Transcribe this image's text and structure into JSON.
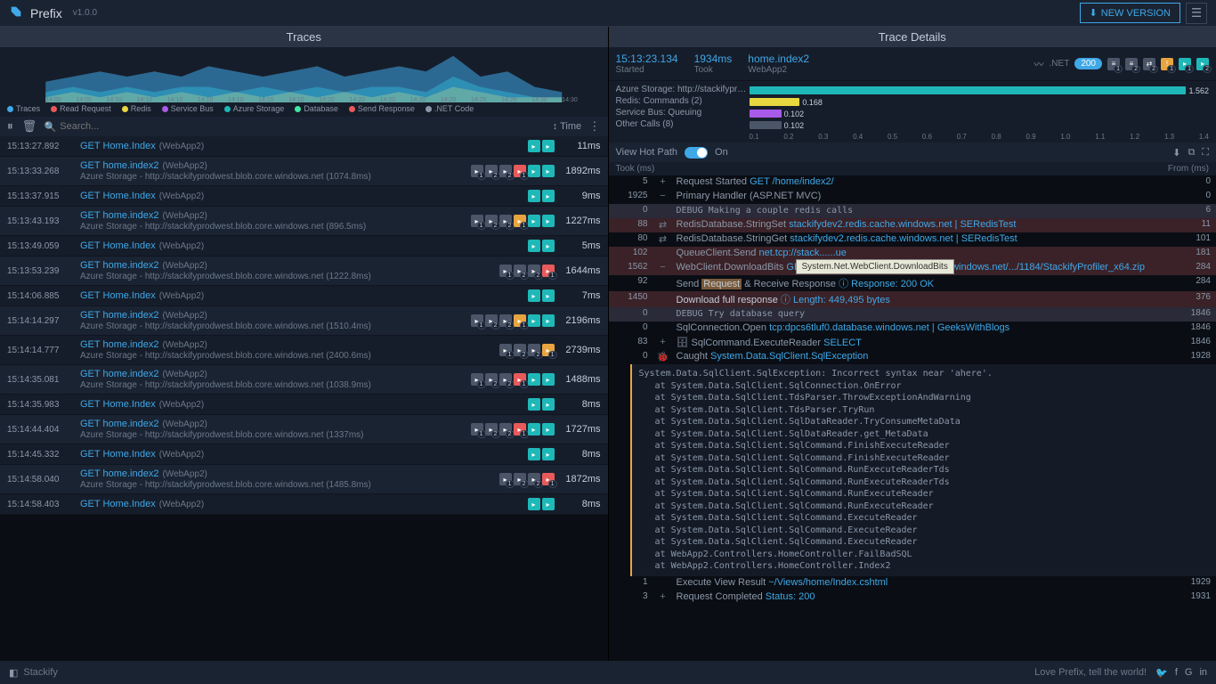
{
  "app": {
    "name": "Prefix",
    "version": "v1.0.0",
    "new_version_label": "NEW VERSION"
  },
  "panels": {
    "left": "Traces",
    "right": "Trace Details"
  },
  "legend": [
    {
      "label": "Traces",
      "color": "#3fa8e8"
    },
    {
      "label": "Read Request",
      "color": "#e85a5a"
    },
    {
      "label": "Redis",
      "color": "#e8d83f"
    },
    {
      "label": "Service Bus",
      "color": "#a85ae8"
    },
    {
      "label": "Azure Storage",
      "color": "#1fb8b8"
    },
    {
      "label": "Database",
      "color": "#3fe8a4"
    },
    {
      "label": "Send Response",
      "color": "#e85a5a"
    },
    {
      "label": ".NET Code",
      "color": "#8b97a8"
    }
  ],
  "chart_data": {
    "type": "area",
    "xlabel": "",
    "ylabel": "Traces",
    "ylim": [
      0,
      10
    ],
    "x_ticks": [
      "14:00",
      "14:00",
      "14:10",
      "14:10",
      "14:10",
      "14:10",
      "14:10",
      "14:10",
      "14:10",
      "14:20",
      "14:20",
      "14:20",
      "14:20",
      "14:20",
      "14:20",
      "14:20",
      "14:30",
      "14:30"
    ],
    "series": [
      {
        "name": "Traces",
        "color": "#3fa8e8",
        "values": [
          4,
          5,
          6,
          5,
          6,
          5,
          7,
          6,
          5,
          6,
          7,
          5,
          6,
          7,
          6,
          9,
          5,
          6,
          3,
          2
        ]
      },
      {
        "name": "Redis",
        "color": "#e8d83f",
        "values": [
          1,
          2,
          1,
          2,
          1,
          2,
          1,
          2,
          1,
          2,
          1,
          2,
          1,
          2,
          1,
          3,
          2,
          1,
          1,
          1
        ]
      },
      {
        "name": "Azure Storage",
        "color": "#1fb8b8",
        "values": [
          2,
          3,
          2,
          3,
          2,
          3,
          3,
          2,
          3,
          2,
          3,
          2,
          3,
          3,
          2,
          5,
          3,
          2,
          1,
          1
        ]
      }
    ]
  },
  "toolbar": {
    "search_placeholder": "Search...",
    "time_label": "Time"
  },
  "traces": [
    {
      "ts": "15:13:27.892",
      "title": "GET Home.Index",
      "app": "(WebApp2)",
      "sub": "",
      "dur": "11ms",
      "icons": [
        {
          "c": "teal"
        },
        {
          "c": "teal"
        }
      ]
    },
    {
      "ts": "15:13:33.268",
      "title": "GET home.index2",
      "app": "(WebApp2)",
      "sub": "Azure Storage - http://stackifyprodwest.blob.core.windows.net (1074.8ms)",
      "dur": "1892ms",
      "icons": [
        {
          "c": "gray",
          "n": "1"
        },
        {
          "c": "gray",
          "n": "2"
        },
        {
          "c": "gray",
          "n": "2"
        },
        {
          "c": "red",
          "n": "1"
        },
        {
          "c": "teal"
        },
        {
          "c": "teal"
        }
      ]
    },
    {
      "ts": "15:13:37.915",
      "title": "GET Home.Index",
      "app": "(WebApp2)",
      "sub": "",
      "dur": "9ms",
      "icons": [
        {
          "c": "teal"
        },
        {
          "c": "teal"
        }
      ]
    },
    {
      "ts": "15:13:43.193",
      "title": "GET home.index2",
      "app": "(WebApp2)",
      "sub": "Azure Storage - http://stackifyprodwest.blob.core.windows.net (896.5ms)",
      "dur": "1227ms",
      "icons": [
        {
          "c": "gray",
          "n": "1"
        },
        {
          "c": "gray",
          "n": "2"
        },
        {
          "c": "gray",
          "n": "2"
        },
        {
          "c": "orange",
          "n": "1"
        },
        {
          "c": "teal"
        },
        {
          "c": "teal"
        }
      ]
    },
    {
      "ts": "15:13:49.059",
      "title": "GET Home.Index",
      "app": "(WebApp2)",
      "sub": "",
      "dur": "5ms",
      "icons": [
        {
          "c": "teal"
        },
        {
          "c": "teal"
        }
      ]
    },
    {
      "ts": "15:13:53.239",
      "title": "GET home.index2",
      "app": "(WebApp2)",
      "sub": "Azure Storage - http://stackifyprodwest.blob.core.windows.net (1222.8ms)",
      "dur": "1644ms",
      "icons": [
        {
          "c": "gray",
          "n": "1"
        },
        {
          "c": "gray",
          "n": "2"
        },
        {
          "c": "gray",
          "n": "2"
        },
        {
          "c": "red",
          "n": "1"
        }
      ]
    },
    {
      "ts": "15:14:06.885",
      "title": "GET Home.Index",
      "app": "(WebApp2)",
      "sub": "",
      "dur": "7ms",
      "icons": [
        {
          "c": "teal"
        },
        {
          "c": "teal"
        }
      ]
    },
    {
      "ts": "15:14:14.297",
      "title": "GET home.index2",
      "app": "(WebApp2)",
      "sub": "Azure Storage - http://stackifyprodwest.blob.core.windows.net (1510.4ms)",
      "dur": "2196ms",
      "icons": [
        {
          "c": "gray",
          "n": "1"
        },
        {
          "c": "gray",
          "n": "2"
        },
        {
          "c": "gray",
          "n": "2"
        },
        {
          "c": "orange",
          "n": "1"
        },
        {
          "c": "teal"
        },
        {
          "c": "teal"
        }
      ]
    },
    {
      "ts": "15:14:14.777",
      "title": "GET home.index2",
      "app": "(WebApp2)",
      "sub": "Azure Storage - http://stackifyprodwest.blob.core.windows.net (2400.6ms)",
      "dur": "2739ms",
      "icons": [
        {
          "c": "gray",
          "n": "1"
        },
        {
          "c": "gray",
          "n": "2"
        },
        {
          "c": "gray",
          "n": "2"
        },
        {
          "c": "orange",
          "n": "1"
        }
      ]
    },
    {
      "ts": "15:14:35.081",
      "title": "GET home.index2",
      "app": "(WebApp2)",
      "sub": "Azure Storage - http://stackifyprodwest.blob.core.windows.net (1038.9ms)",
      "dur": "1488ms",
      "icons": [
        {
          "c": "gray",
          "n": "1"
        },
        {
          "c": "gray",
          "n": "2"
        },
        {
          "c": "gray",
          "n": "2"
        },
        {
          "c": "red",
          "n": "1"
        },
        {
          "c": "teal"
        },
        {
          "c": "teal"
        }
      ]
    },
    {
      "ts": "15:14:35.983",
      "title": "GET Home.Index",
      "app": "(WebApp2)",
      "sub": "",
      "dur": "8ms",
      "icons": [
        {
          "c": "teal"
        },
        {
          "c": "teal"
        }
      ]
    },
    {
      "ts": "15:14:44.404",
      "title": "GET home.index2",
      "app": "(WebApp2)",
      "sub": "Azure Storage - http://stackifyprodwest.blob.core.windows.net (1337ms)",
      "dur": "1727ms",
      "icons": [
        {
          "c": "gray",
          "n": "1"
        },
        {
          "c": "gray",
          "n": "2"
        },
        {
          "c": "gray",
          "n": "2"
        },
        {
          "c": "red",
          "n": "1"
        },
        {
          "c": "teal"
        },
        {
          "c": "teal"
        }
      ]
    },
    {
      "ts": "15:14:45.332",
      "title": "GET Home.Index",
      "app": "(WebApp2)",
      "sub": "",
      "dur": "8ms",
      "icons": [
        {
          "c": "teal"
        },
        {
          "c": "teal"
        }
      ]
    },
    {
      "ts": "15:14:58.040",
      "title": "GET home.index2",
      "app": "(WebApp2)",
      "sub": "Azure Storage - http://stackifyprodwest.blob.core.windows.net (1485.8ms)",
      "dur": "1872ms",
      "icons": [
        {
          "c": "gray",
          "n": "1"
        },
        {
          "c": "gray",
          "n": "2"
        },
        {
          "c": "gray",
          "n": "2"
        },
        {
          "c": "red",
          "n": "1"
        }
      ]
    },
    {
      "ts": "15:14:58.403",
      "title": "GET Home.Index",
      "app": "(WebApp2)",
      "sub": "",
      "dur": "8ms",
      "icons": [
        {
          "c": "teal"
        },
        {
          "c": "teal"
        }
      ]
    }
  ],
  "footer": {
    "brand": "Stackify",
    "tagline": "Love Prefix, tell the world!"
  },
  "detail_header": {
    "started": "15:13:23.134",
    "started_lbl": "Started",
    "took": "1934ms",
    "took_lbl": "Took",
    "route": "home.index2",
    "app": "WebApp2",
    "net": ".NET",
    "status": "200"
  },
  "detail_bars": {
    "rows": [
      {
        "label": "Azure Storage: http://stackifyprodwes...",
        "color": "#1fb8b8",
        "val": 1.562,
        "pct": 100
      },
      {
        "label": "Redis: Commands (2)",
        "color": "#e8d83f",
        "val": 0.168,
        "pct": 11
      },
      {
        "label": "Service Bus: Queuing",
        "color": "#a85ae8",
        "val": 0.102,
        "pct": 7
      },
      {
        "label": "Other Calls (8)",
        "color": "#4a5568",
        "val": 0.102,
        "pct": 7
      }
    ],
    "axis": [
      "0.1",
      "0.2",
      "0.3",
      "0.4",
      "0.5",
      "0.6",
      "0.7",
      "0.8",
      "0.9",
      "1.0",
      "1.1",
      "1.2",
      "1.3",
      "1.4"
    ]
  },
  "hotpath": {
    "label": "View Hot Path",
    "on": "On"
  },
  "columns": {
    "took": "Took (ms)",
    "from": "From (ms)"
  },
  "tooltip": "System.Net.WebClient.DownloadBits",
  "events": [
    {
      "took": "5",
      "g": "+",
      "body": [
        {
          "t": "Request Started ",
          "c": "gray"
        },
        {
          "t": "GET /home/index2/",
          "c": "link"
        }
      ],
      "from": "0"
    },
    {
      "took": "1925",
      "g": "−",
      "body": [
        {
          "t": "Primary Handler (ASP.NET MVC)",
          "c": "gray"
        }
      ],
      "from": "0"
    },
    {
      "took": "0",
      "g": "",
      "mono": "DEBUG Making a couple redis calls",
      "from": "6",
      "cls": "hl2"
    },
    {
      "took": "88",
      "g": "⇄",
      "body": [
        {
          "t": "RedisDatabase.StringSet  ",
          "c": "gray"
        },
        {
          "t": "stackifydev2.redis.cache.windows.net | SERedisTest",
          "c": "link"
        }
      ],
      "from": "11",
      "cls": "hl"
    },
    {
      "took": "80",
      "g": "⇄",
      "body": [
        {
          "t": "RedisDatabase.StringGet  ",
          "c": "gray"
        },
        {
          "t": "stackifydev2.redis.cache.windows.net | SERedisTest",
          "c": "link"
        }
      ],
      "from": "101"
    },
    {
      "took": "102",
      "g": "",
      "body": [
        {
          "t": "QueueClient.Send  ",
          "c": "gray"
        },
        {
          "t": "net.tcp://stack...",
          "c": "link"
        },
        {
          "t": "...ue",
          "c": "link"
        }
      ],
      "from": "181",
      "cls": "hl"
    },
    {
      "took": "1562",
      "g": "−",
      "body": [
        {
          "t": "WebClient.DownloadBits  ",
          "c": "gray"
        },
        {
          "t": "GET ",
          "c": "link"
        },
        {
          "t": "http://stackifyprodwest.blob.core.windows.net/.../1184/StackifyProfiler_x64.zip",
          "c": "link"
        }
      ],
      "from": "284",
      "cls": "hl"
    },
    {
      "took": "92",
      "g": "",
      "body": [
        {
          "t": "Send ",
          "c": "gray"
        },
        {
          "t": "Request",
          "c": "white",
          "bg": "#7a5a3a"
        },
        {
          "t": " & Receive Response ",
          "c": "gray"
        },
        {
          "t": "ⓘ  Response: 200 OK",
          "c": "link"
        }
      ],
      "from": "284"
    },
    {
      "took": "1450",
      "g": "",
      "body": [
        {
          "t": "Download full response ",
          "c": "white"
        },
        {
          "t": "ⓘ  Length: 449,495 bytes",
          "c": "link"
        }
      ],
      "from": "376",
      "cls": "hl"
    },
    {
      "took": "0",
      "g": "",
      "mono": "DEBUG Try database query",
      "from": "1846",
      "cls": "hl2"
    },
    {
      "took": "0",
      "g": "",
      "body": [
        {
          "t": "SqlConnection.Open  ",
          "c": "gray"
        },
        {
          "t": "tcp:dpcs6tluf0.database.windows.net | GeeksWithBlogs",
          "c": "link"
        }
      ],
      "from": "1846"
    },
    {
      "took": "83",
      "g": "+",
      "body": [
        {
          "t": "🗄 SqlCommand.ExecuteReader  ",
          "c": "gray"
        },
        {
          "t": "SELECT",
          "c": "link"
        }
      ],
      "from": "1846"
    },
    {
      "took": "0",
      "g": "🐞",
      "body": [
        {
          "t": "Caught  ",
          "c": "gray"
        },
        {
          "t": "System.Data.SqlClient.SqlException",
          "c": "link"
        }
      ],
      "from": "1928"
    }
  ],
  "stack": [
    "System.Data.SqlClient.SqlException: Incorrect syntax near 'ahere'.",
    "   at System.Data.SqlClient.SqlConnection.OnError",
    "   at System.Data.SqlClient.TdsParser.ThrowExceptionAndWarning",
    "   at System.Data.SqlClient.TdsParser.TryRun",
    "   at System.Data.SqlClient.SqlDataReader.TryConsumeMetaData",
    "   at System.Data.SqlClient.SqlDataReader.get_MetaData",
    "   at System.Data.SqlClient.SqlCommand.FinishExecuteReader",
    "   at System.Data.SqlClient.SqlCommand.FinishExecuteReader",
    "   at System.Data.SqlClient.SqlCommand.RunExecuteReaderTds",
    "   at System.Data.SqlClient.SqlCommand.RunExecuteReaderTds",
    "   at System.Data.SqlClient.SqlCommand.RunExecuteReader",
    "   at System.Data.SqlClient.SqlCommand.RunExecuteReader",
    "   at System.Data.SqlClient.SqlCommand.ExecuteReader",
    "   at System.Data.SqlClient.SqlCommand.ExecuteReader",
    "   at System.Data.SqlClient.SqlCommand.ExecuteReader",
    "   at WebApp2.Controllers.HomeController.FailBadSQL",
    "   at WebApp2.Controllers.HomeController.Index2"
  ],
  "events_tail": [
    {
      "took": "1",
      "g": "",
      "body": [
        {
          "t": "Execute View Result  ",
          "c": "gray"
        },
        {
          "t": "~/Views/home/Index.cshtml",
          "c": "link"
        }
      ],
      "from": "1929"
    },
    {
      "took": "3",
      "g": "+",
      "body": [
        {
          "t": "Request Completed  ",
          "c": "gray"
        },
        {
          "t": "Status: 200",
          "c": "link"
        }
      ],
      "from": "1931"
    }
  ]
}
